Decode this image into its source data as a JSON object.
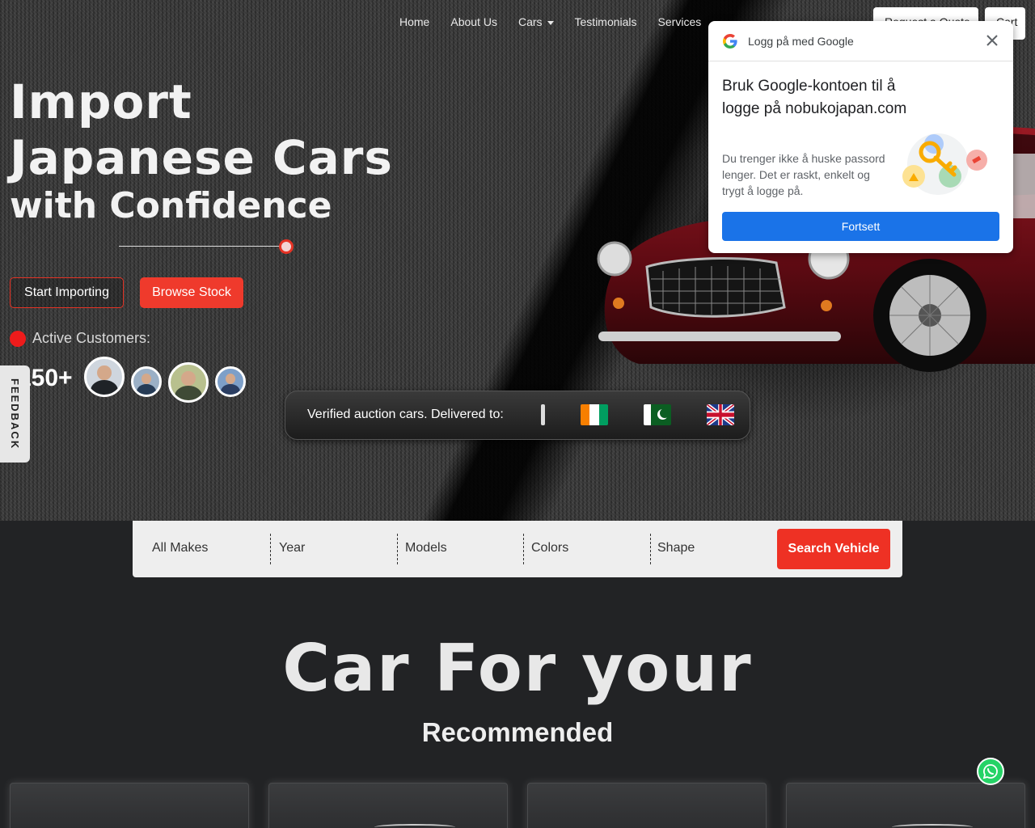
{
  "nav": {
    "items": [
      {
        "label": "Home"
      },
      {
        "label": "About Us"
      },
      {
        "label": "Cars"
      },
      {
        "label": "Testimonials"
      },
      {
        "label": "Services"
      }
    ],
    "button1_label": "Request a Quote",
    "button2_label": "Cart"
  },
  "hero": {
    "title_line1": "Import",
    "title_line2": "Japanese Cars",
    "title_line3": "with Confidence",
    "start_label": "Start Importing",
    "browse_label": "Browse Stock",
    "active_label": "Active Customers:",
    "customer_count": "150+"
  },
  "feedback_label": "FEEDBACK",
  "delivered": {
    "text": "Verified auction cars. Delivered to:",
    "flags": [
      "cote-divoire-flag",
      "pakistan-flag",
      "united-kingdom-flag"
    ]
  },
  "google_popup": {
    "title": "Logg på med Google",
    "headline": "Bruk Google-kontoen til å logge på nobukojapan.com",
    "body": "Du trenger ikke å huske passord lenger. Det er raskt, enkelt og trygt å logge på.",
    "continue_label": "Fortsett"
  },
  "search": {
    "makes": "All Makes",
    "year": "Year",
    "models": "Models",
    "colors": "Colors",
    "shape": "Shape",
    "button_label": "Search Vehicle"
  },
  "recommended": {
    "title": "Car For your",
    "subtitle": "Recommended"
  },
  "colors": {
    "accent": "#ee3124",
    "google_blue": "#1a73e8",
    "whatsapp": "#25d366"
  }
}
